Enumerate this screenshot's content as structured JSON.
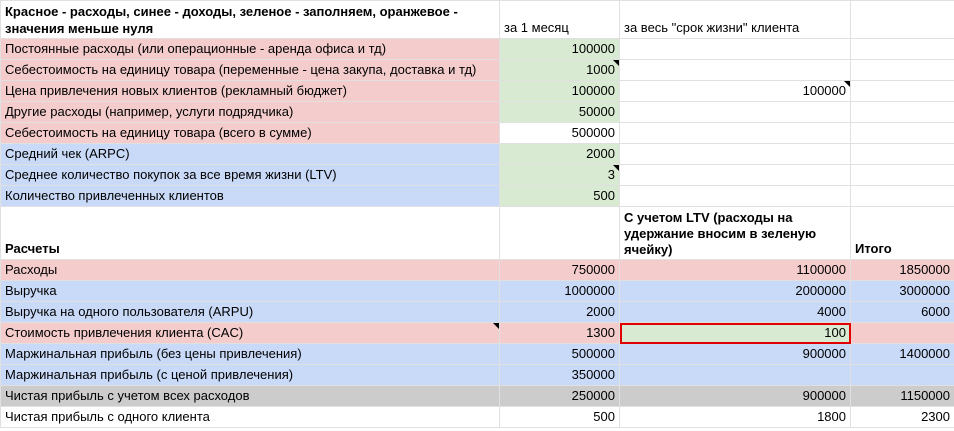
{
  "header": {
    "legend": "Красное - расходы, синее - доходы, зеленое - заполняем, оранжевое - значения меньше нуля",
    "col_month": "за 1 месяц",
    "col_lifetime": "за весь \"срок жизни\" клиента",
    "col_total": ""
  },
  "colors": {
    "expense": "#f4cccc",
    "income": "#c9daf8",
    "input": "#d9ead3",
    "net": "#cccccc",
    "selection": "#e00000"
  },
  "inputs": [
    {
      "label": "Постоянные расходы (или операционные - аренда офиса и тд)",
      "month": "100000",
      "lifetime": ""
    },
    {
      "label": "Себестоимость на единицу товара (переменные - цена закупа, доставка и тд)",
      "month": "1000",
      "lifetime": ""
    },
    {
      "label": "Цена привлечения новых клиентов (рекламный бюджет)",
      "month": "100000",
      "lifetime": "100000"
    },
    {
      "label": "Другие расходы (например, услуги подрядчика)",
      "month": "50000",
      "lifetime": ""
    },
    {
      "label": "Себестоимость на единицу товара (всего в сумме)",
      "month": "500000",
      "lifetime": ""
    },
    {
      "label": "Средний чек (ARPC)",
      "month": "2000",
      "lifetime": ""
    },
    {
      "label": "Среднее количество покупок за все время жизни (LTV)",
      "month": "3",
      "lifetime": ""
    },
    {
      "label": "Количество привлеченных клиентов",
      "month": "500",
      "lifetime": ""
    }
  ],
  "calc_header": {
    "label": "Расчеты",
    "month": "",
    "lifetime": "С учетом LTV (расходы на удержание вносим в зеленую ячейку)",
    "total": "Итого"
  },
  "calc": [
    {
      "label": "Расходы",
      "month": "750000",
      "lifetime": "1100000",
      "total": "1850000"
    },
    {
      "label": "Выручка",
      "month": "1000000",
      "lifetime": "2000000",
      "total": "3000000"
    },
    {
      "label": "Выручка на одного пользователя (ARPU)",
      "month": "2000",
      "lifetime": "4000",
      "total": "6000"
    },
    {
      "label": "Стоимость привлечения клиента (CAC)",
      "month": "1300",
      "lifetime": "100",
      "total": ""
    },
    {
      "label": "Маржинальная прибыль (без цены привлечения)",
      "month": "500000",
      "lifetime": "900000",
      "total": "1400000"
    },
    {
      "label": "Маржинальная прибыль (с ценой привлечения)",
      "month": "350000",
      "lifetime": "",
      "total": ""
    },
    {
      "label": "Чистая прибыль с учетом всех расходов",
      "month": "250000",
      "lifetime": "900000",
      "total": "1150000"
    },
    {
      "label": "Чистая прибыль с одного клиента",
      "month": "500",
      "lifetime": "1800",
      "total": "2300"
    }
  ]
}
